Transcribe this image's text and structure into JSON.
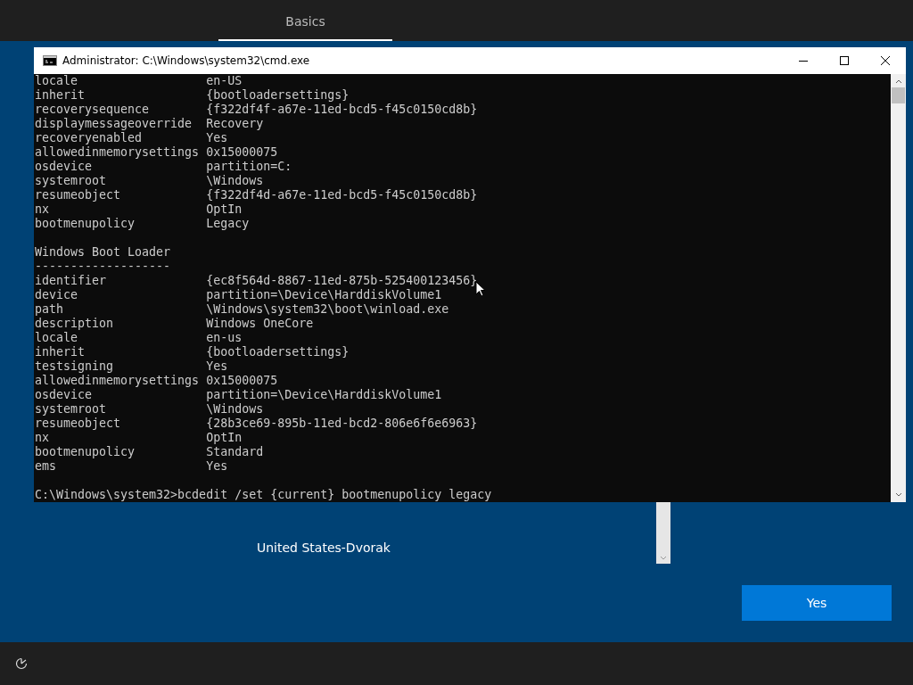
{
  "header": {
    "tabs": [
      {
        "label": "Basics",
        "selected": true
      }
    ]
  },
  "console_window": {
    "title": "Administrator: C:\\Windows\\system32\\cmd.exe",
    "sections": [
      {
        "entries": [
          [
            "locale",
            "en-US"
          ],
          [
            "inherit",
            "{bootloadersettings}"
          ],
          [
            "recoverysequence",
            "{f322df4f-a67e-11ed-bcd5-f45c0150cd8b}"
          ],
          [
            "displaymessageoverride",
            "Recovery"
          ],
          [
            "recoveryenabled",
            "Yes"
          ],
          [
            "allowedinmemorysettings",
            "0x15000075"
          ],
          [
            "osdevice",
            "partition=C:"
          ],
          [
            "systemroot",
            "\\Windows"
          ],
          [
            "resumeobject",
            "{f322df4d-a67e-11ed-bcd5-f45c0150cd8b}"
          ],
          [
            "nx",
            "OptIn"
          ],
          [
            "bootmenupolicy",
            "Legacy"
          ]
        ]
      },
      {
        "heading": "Windows Boot Loader",
        "rule": "-------------------",
        "entries": [
          [
            "identifier",
            "{ec8f564d-8867-11ed-875b-525400123456}"
          ],
          [
            "device",
            "partition=\\Device\\HarddiskVolume1"
          ],
          [
            "path",
            "\\Windows\\system32\\boot\\winload.exe"
          ],
          [
            "description",
            "Windows OneCore"
          ],
          [
            "locale",
            "en-us"
          ],
          [
            "inherit",
            "{bootloadersettings}"
          ],
          [
            "testsigning",
            "Yes"
          ],
          [
            "allowedinmemorysettings",
            "0x15000075"
          ],
          [
            "osdevice",
            "partition=\\Device\\HarddiskVolume1"
          ],
          [
            "systemroot",
            "\\Windows"
          ],
          [
            "resumeobject",
            "{28b3ce69-895b-11ed-bcd2-806e6f6e6963}"
          ],
          [
            "nx",
            "OptIn"
          ],
          [
            "bootmenupolicy",
            "Standard"
          ],
          [
            "ems",
            "Yes"
          ]
        ]
      }
    ],
    "prompt": "C:\\Windows\\system32>bcdedit /set {current} bootmenupolicy legacy"
  },
  "keyboard_list": {
    "items": [
      "United States-Dvorak"
    ]
  },
  "buttons": [
    "Yes"
  ]
}
